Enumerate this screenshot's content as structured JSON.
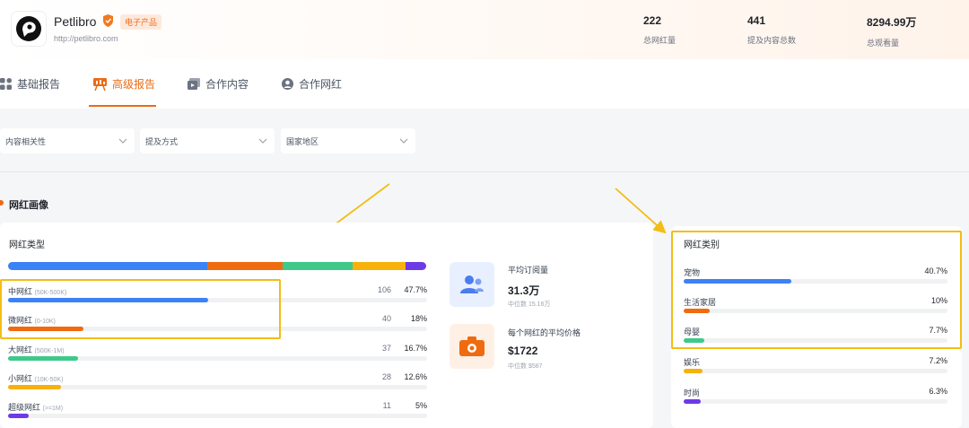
{
  "brand": {
    "name": "Petlibro",
    "tag": "电子产品",
    "url": "http://petlibro.com"
  },
  "stats": [
    {
      "value": "222",
      "label": "总网红量"
    },
    {
      "value": "441",
      "label": "提及内容总数"
    },
    {
      "value": "8294.99万",
      "label": "总观看量"
    }
  ],
  "tabs": [
    {
      "label": "基础报告",
      "icon": "grid-icon",
      "active": false
    },
    {
      "label": "高级报告",
      "icon": "report-icon",
      "active": true
    },
    {
      "label": "合作内容",
      "icon": "media-icon",
      "active": false
    },
    {
      "label": "合作网红",
      "icon": "user-icon",
      "active": false
    }
  ],
  "filters": [
    {
      "label": "内容相关性"
    },
    {
      "label": "提及方式"
    },
    {
      "label": "国家地区"
    }
  ],
  "section": {
    "title": "网红画像"
  },
  "influencer_types": {
    "title": "网红类型",
    "rows": [
      {
        "name": "中网红",
        "range": "(50K-500K)",
        "count": "106",
        "pct": "47.7%",
        "share": 0.477,
        "color": "#3b82f6"
      },
      {
        "name": "微网红",
        "range": "(0-10K)",
        "count": "40",
        "pct": "18%",
        "share": 0.18,
        "color": "#f06b0f"
      },
      {
        "name": "大网红",
        "range": "(500K-1M)",
        "count": "37",
        "pct": "16.7%",
        "share": 0.167,
        "color": "#3ec98b"
      },
      {
        "name": "小网红",
        "range": "(10K-50K)",
        "count": "28",
        "pct": "12.6%",
        "share": 0.126,
        "color": "#f7b10a"
      },
      {
        "name": "超级网红",
        "range": "(>=1M)",
        "count": "11",
        "pct": "5%",
        "share": 0.05,
        "color": "#6d3ae8"
      }
    ]
  },
  "metrics": [
    {
      "label": "平均订阅量",
      "value": "31.3万",
      "sub": "中位数 15.16万",
      "icon": "users-icon",
      "bg": "#e8f0ff",
      "color": "#4a7cf0"
    },
    {
      "label": "每个网红的平均价格",
      "value": "$1722",
      "sub": "中位数 $587",
      "icon": "camera-icon",
      "bg": "#fff0e6",
      "color": "#f06b0f"
    }
  ],
  "categories": {
    "title": "网红类别",
    "rows": [
      {
        "name": "宠物",
        "pct": "40.7%",
        "share": 0.407,
        "color": "#3b82f6"
      },
      {
        "name": "生活家居",
        "pct": "10%",
        "share": 0.1,
        "color": "#f06b0f"
      },
      {
        "name": "母婴",
        "pct": "7.7%",
        "share": 0.077,
        "color": "#3ec98b"
      },
      {
        "name": "娱乐",
        "pct": "7.2%",
        "share": 0.072,
        "color": "#f7b10a"
      },
      {
        "name": "时尚",
        "pct": "6.3%",
        "share": 0.063,
        "color": "#6d3ae8"
      }
    ]
  },
  "colors": {
    "accent": "#ea6b16",
    "highlight": "#f3bd14"
  }
}
